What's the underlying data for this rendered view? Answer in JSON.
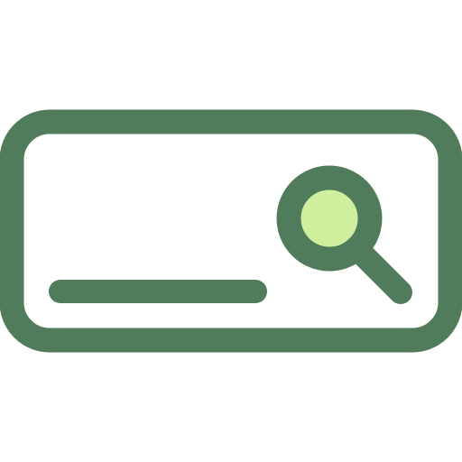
{
  "icon": {
    "name": "search-field-icon",
    "colors": {
      "stroke": "#507c5c",
      "lens_fill": "#cfef9f",
      "field_fill": "#ffffff"
    },
    "parts": [
      "search-field-frame-icon",
      "text-placeholder-line-icon",
      "magnifier-icon"
    ]
  }
}
